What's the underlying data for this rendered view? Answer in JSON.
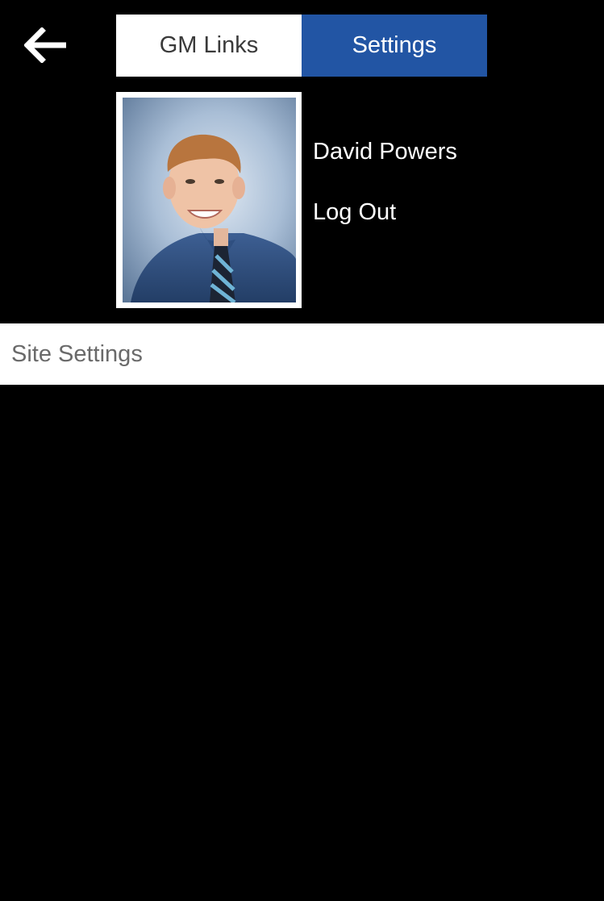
{
  "header": {
    "back_icon": "arrow-left-icon",
    "tabs": [
      {
        "label": "GM Links",
        "active": false
      },
      {
        "label": "Settings",
        "active": true
      }
    ],
    "active_color": "#2255a4"
  },
  "profile": {
    "name": "David Powers",
    "logout_label": "Log Out",
    "photo_alt": "David Powers"
  },
  "menu": {
    "site_settings_label": "Site Settings"
  }
}
